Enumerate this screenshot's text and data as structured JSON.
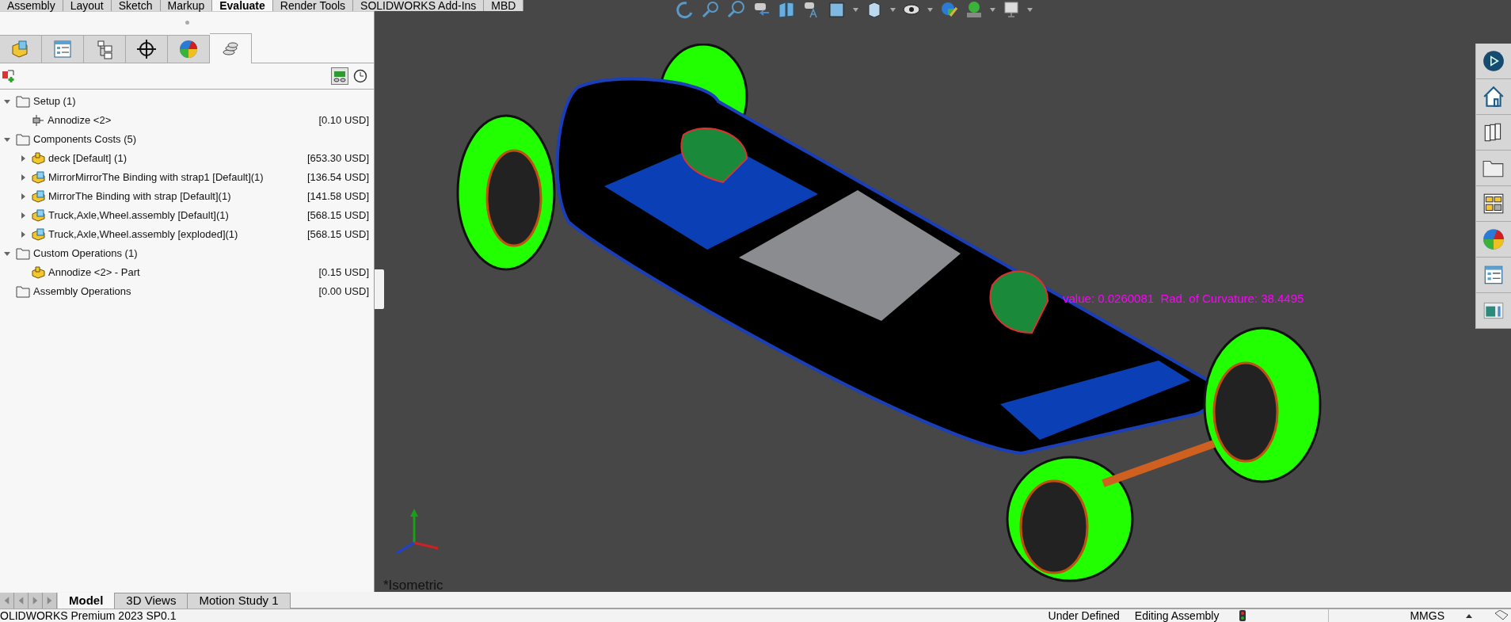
{
  "ribbon_tabs": [
    {
      "label": "Assembly",
      "selected": false
    },
    {
      "label": "Layout",
      "selected": false
    },
    {
      "label": "Sketch",
      "selected": false
    },
    {
      "label": "Markup",
      "selected": false
    },
    {
      "label": "Evaluate",
      "selected": true
    },
    {
      "label": "Render Tools",
      "selected": false
    },
    {
      "label": "SOLIDWORKS Add-Ins",
      "selected": false
    },
    {
      "label": "MBD",
      "selected": false
    }
  ],
  "panel_tabs": [
    {
      "kind": "part",
      "selected": false
    },
    {
      "kind": "property",
      "selected": false
    },
    {
      "kind": "config",
      "selected": false
    },
    {
      "kind": "dimxpert",
      "selected": false
    },
    {
      "kind": "appearance",
      "selected": false
    },
    {
      "kind": "costing",
      "selected": true
    }
  ],
  "tree": [
    {
      "label": "Setup (1)",
      "kind": "folder",
      "expanded": true,
      "children": [
        {
          "label": "Annodize <2>",
          "kind": "operation",
          "cost": "[0.10 USD]"
        }
      ]
    },
    {
      "label": "Components Costs (5)",
      "kind": "folder",
      "expanded": true,
      "children": [
        {
          "label": "deck [Default] (1)",
          "kind": "part",
          "cost": "[653.30 USD]",
          "expanded": false
        },
        {
          "label": "MirrorMirrorThe Binding with strap1 [Default](1)",
          "kind": "assembly",
          "cost": "[136.54 USD]",
          "expanded": false
        },
        {
          "label": "MirrorThe Binding with strap [Default](1)",
          "kind": "assembly",
          "cost": "[141.58 USD]",
          "expanded": false
        },
        {
          "label": "Truck,Axle,Wheel.assembly [Default](1)",
          "kind": "assembly",
          "cost": "[568.15 USD]",
          "expanded": false
        },
        {
          "label": "Truck,Axle,Wheel.assembly [exploded](1)",
          "kind": "assembly",
          "cost": "[568.15 USD]",
          "expanded": false
        }
      ]
    },
    {
      "label": "Custom Operations (1)",
      "kind": "folder",
      "expanded": true,
      "children": [
        {
          "label": "Annodize <2> - Part",
          "kind": "part",
          "cost": "[0.15 USD]"
        }
      ]
    },
    {
      "label": "Assembly Operations",
      "kind": "folder",
      "cost": "[0.00 USD]"
    }
  ],
  "viewport": {
    "annotation": "value: 0.0260081  Rad. of Curvature: 38.4495",
    "view_name": "*Isometric"
  },
  "bottom_tabs": [
    {
      "label": "Model",
      "selected": true
    },
    {
      "label": "3D Views",
      "selected": false
    },
    {
      "label": "Motion Study 1",
      "selected": false
    }
  ],
  "status_bar": {
    "product": "OLIDWORKS Premium 2023 SP0.1",
    "state": "Under Defined",
    "mode": "Editing Assembly",
    "units": "MMGS"
  }
}
